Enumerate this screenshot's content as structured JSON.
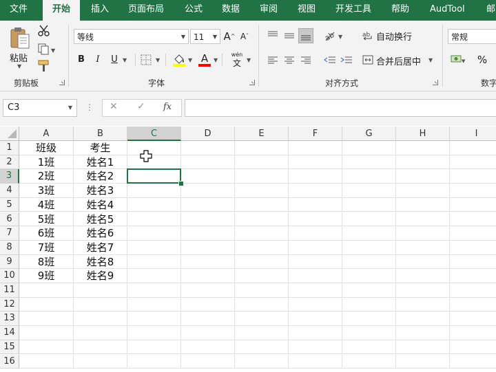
{
  "menu": {
    "tabs": [
      {
        "label": "文件",
        "active": false
      },
      {
        "label": "开始",
        "active": true
      },
      {
        "label": "插入",
        "active": false
      },
      {
        "label": "页面布局",
        "active": false
      },
      {
        "label": "公式",
        "active": false
      },
      {
        "label": "数据",
        "active": false
      },
      {
        "label": "审阅",
        "active": false
      },
      {
        "label": "视图",
        "active": false
      },
      {
        "label": "开发工具",
        "active": false
      },
      {
        "label": "帮助",
        "active": false
      },
      {
        "label": "AudTool",
        "active": false
      },
      {
        "label": "邮",
        "active": false
      }
    ]
  },
  "ribbon": {
    "clipboard": {
      "paste_label": "粘贴",
      "group_label": "剪贴板"
    },
    "font": {
      "font_name": "等线",
      "font_size": "11",
      "bold": "B",
      "italic": "I",
      "underline": "U",
      "grow": "A",
      "shrink": "A",
      "font_color_letter": "A",
      "phonetic_top": "wén",
      "phonetic_bottom": "文",
      "group_label": "字体",
      "fill_color": "#ffff00",
      "font_color": "#ff0000"
    },
    "alignment": {
      "wrap_text": "自动换行",
      "merge_center": "合并后居中",
      "group_label": "对齐方式"
    },
    "number": {
      "format": "常规",
      "percent": "%",
      "group_label": "数字"
    }
  },
  "formula_bar": {
    "name_box": "C3",
    "cancel": "✕",
    "enter": "✓",
    "fx": "fx",
    "content": ""
  },
  "sheet": {
    "columns": [
      "A",
      "B",
      "C",
      "D",
      "E",
      "F",
      "G",
      "H",
      "I"
    ],
    "rows": [
      "1",
      "2",
      "3",
      "4",
      "5",
      "6",
      "7",
      "8",
      "9",
      "10",
      "11",
      "12",
      "13",
      "14",
      "15",
      "16"
    ],
    "selected_column": "C",
    "selected_row": "3",
    "cells": {
      "A": [
        "班级",
        "1班",
        "2班",
        "3班",
        "4班",
        "5班",
        "6班",
        "7班",
        "8班",
        "9班",
        "",
        "",
        "",
        "",
        "",
        ""
      ],
      "B": [
        "考生",
        "姓名1",
        "姓名2",
        "姓名3",
        "姓名4",
        "姓名5",
        "姓名6",
        "姓名7",
        "姓名8",
        "姓名9",
        "",
        "",
        "",
        "",
        "",
        ""
      ]
    }
  },
  "colors": {
    "excel_green": "#217346"
  }
}
